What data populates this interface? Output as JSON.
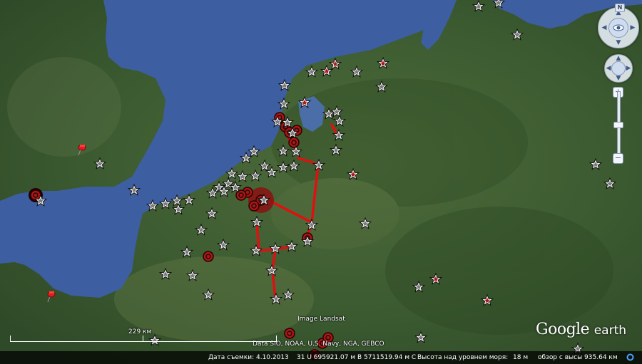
{
  "app": {
    "name": "Google Earth"
  },
  "logo": {
    "word1": "Google",
    "word2": "earth"
  },
  "map": {
    "imagery_credit": "Image Landsat",
    "data_credit": "Data SIO, NOAA, U.S. Navy, NGA, GEBCO",
    "scale_label": "229 км"
  },
  "navigation": {
    "north_label": "N",
    "zoom_in": "+",
    "zoom_out": "−"
  },
  "status_bar": {
    "imagery_date": "Дата съемки: 4.10.2013",
    "coordinates": "31 U 695921.07 м В 5711519.94 м С",
    "elevation": "Высота над уровнем моря:",
    "elevation_value": "18 м",
    "eye_altitude": "обзор с высы 935.64 км"
  },
  "colors": {
    "sea": "#3d5ea0",
    "land": "#3f5f32",
    "route": "#e01010",
    "star_marker": "#ffffff",
    "pin": "#d81c1c"
  },
  "markers": {
    "star_icon": "star-placemark-icon",
    "circle_icon": "red-circle-placemark-icon",
    "pin_icon": "red-pushpin-icon"
  }
}
